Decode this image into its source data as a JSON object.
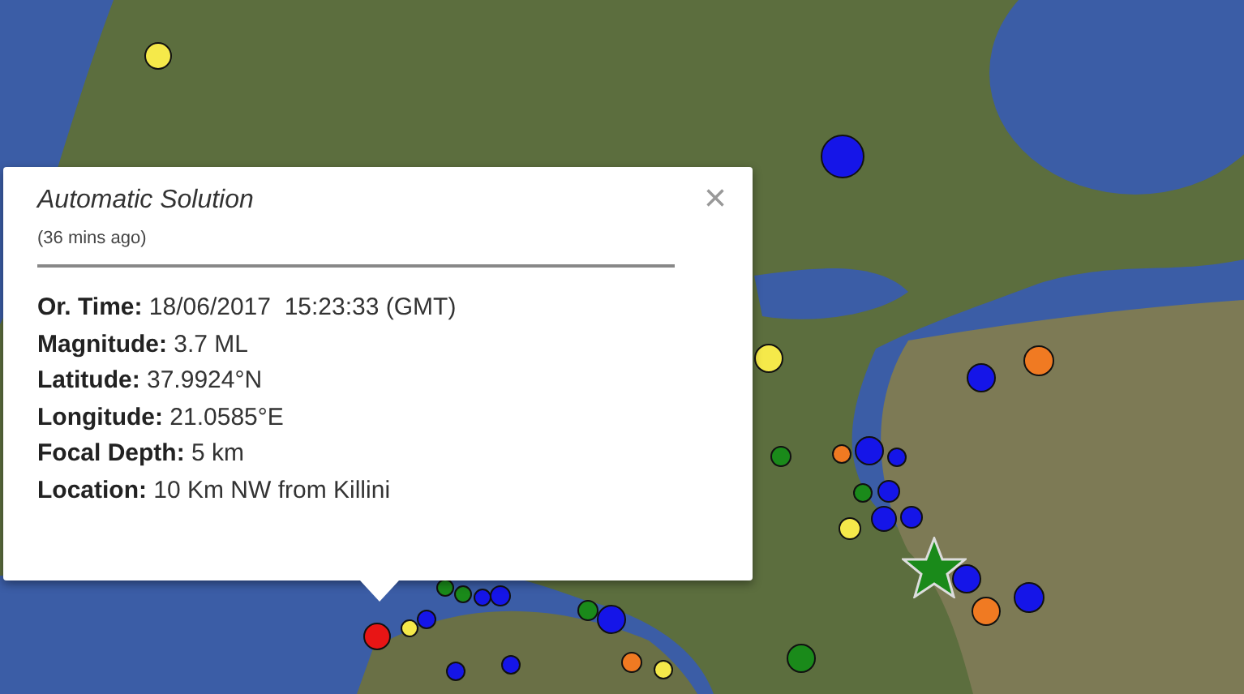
{
  "popup": {
    "title": "Automatic Solution",
    "subtitle": "(36 mins ago)",
    "close": "×",
    "fields": [
      {
        "label": "Or. Time:",
        "value": "18/06/2017  15:23:33 (GMT)"
      },
      {
        "label": "Magnitude:",
        "value": "3.7 ML"
      },
      {
        "label": "Latitude:",
        "value": "37.9924°N"
      },
      {
        "label": "Longitude:",
        "value": "21.0585°E"
      },
      {
        "label": "Focal Depth:",
        "value": "5 km"
      },
      {
        "label": "Location:",
        "value": "10 Km NW from Killini"
      }
    ]
  },
  "markers": [
    {
      "color": "#f5e94a"
    },
    {
      "color": "#1515e8"
    },
    {
      "color": "#f5e94a"
    },
    {
      "color": "#f07a22"
    },
    {
      "color": "#1515e8"
    },
    {
      "color": "#1a8a1a"
    },
    {
      "color": "#f07a22"
    },
    {
      "color": "#1515e8"
    },
    {
      "color": "#1515e8"
    },
    {
      "color": "#1a8a1a"
    },
    {
      "color": "#f5e94a"
    },
    {
      "color": "#1515e8"
    },
    {
      "color": "#1515e8"
    },
    {
      "color": "#1515e8"
    },
    {
      "color": "#1515e8"
    },
    {
      "color": "#f07a22"
    },
    {
      "color": "#1515e8"
    },
    {
      "color": "#1a8a1a"
    },
    {
      "color": "#f5e94a"
    },
    {
      "color": "#1515e8"
    },
    {
      "color": "#1a8a1a"
    },
    {
      "color": "#1a8a1a"
    },
    {
      "color": "#1515e8"
    },
    {
      "color": "#1515e8"
    },
    {
      "color": "#1a8a1a"
    },
    {
      "color": "#1515e8"
    },
    {
      "color": "#f07a22"
    },
    {
      "color": "#f5e94a"
    },
    {
      "color": "#1515e8"
    },
    {
      "color": "#1515e8"
    },
    {
      "color": "#e81515"
    }
  ]
}
